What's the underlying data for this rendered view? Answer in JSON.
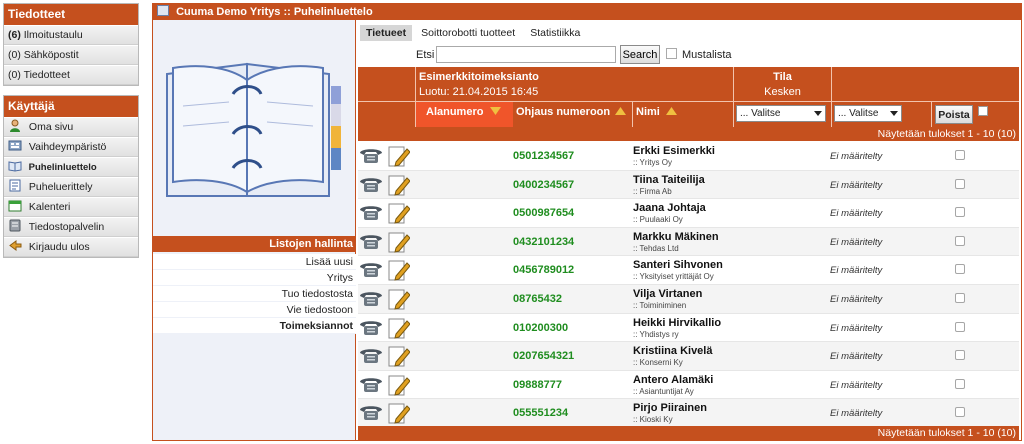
{
  "sidebar": {
    "section1": {
      "title": "Tiedotteet",
      "items": [
        {
          "count": "(6)",
          "label": "Ilmoitustaulu"
        },
        {
          "count": "(0)",
          "label": "Sähköpostit"
        },
        {
          "count": "(0)",
          "label": "Tiedotteet"
        }
      ]
    },
    "section2": {
      "title": "Käyttäjä",
      "items": [
        {
          "label": "Oma sivu",
          "icon": "user-icon"
        },
        {
          "label": "Vaihdeympäristö",
          "icon": "switchboard-icon"
        },
        {
          "label": "Puhelinluettelo",
          "icon": "phonebook-icon"
        },
        {
          "label": "Puheluerittely",
          "icon": "call-log-icon"
        },
        {
          "label": "Kalenteri",
          "icon": "calendar-icon"
        },
        {
          "label": "Tiedostopalvelin",
          "icon": "file-server-icon"
        },
        {
          "label": "Kirjaudu ulos",
          "icon": "logout-icon"
        }
      ]
    }
  },
  "panel": {
    "title": "Cuuma Demo Yritys :: Puhelinluettelo"
  },
  "list_mgmt": {
    "title": "Listojen hallinta",
    "items": [
      "Lisää uusi",
      "Yritys",
      "Tuo tiedostosta",
      "Vie tiedostoon",
      "Toimeksiannot"
    ]
  },
  "tabs": [
    "Tietueet",
    "Soittorobotti tuotteet",
    "Statistiikka"
  ],
  "search": {
    "label": "Etsi",
    "value": "",
    "button": "Search",
    "blacklist_label": "Mustalista"
  },
  "grid": {
    "assignment_title": "Esimerkkitoimeksianto",
    "created": "Luotu: 21.04.2015 16:45",
    "status_title": "Tila",
    "status_value": "Kesken",
    "col_number": "Alanumero",
    "col_redirect": "Ohjaus numeroon",
    "col_name": "Nimi",
    "select1": "... Valitse",
    "select2": "... Valitse",
    "delete_button": "Poista",
    "results_text": "Näytetään tulokset 1 - 10 (10)"
  },
  "rows": [
    {
      "number": "0501234567",
      "name": "Erkki Esimerkki",
      "company": ":: Yritys Oy",
      "status": "Ei määritelty"
    },
    {
      "number": "0400234567",
      "name": "Tiina Taiteilija",
      "company": ":: Firma Ab",
      "status": "Ei määritelty"
    },
    {
      "number": "0500987654",
      "name": "Jaana Johtaja",
      "company": ":: Puulaaki Oy",
      "status": "Ei määritelty"
    },
    {
      "number": "0432101234",
      "name": "Markku Mäkinen",
      "company": ":: Tehdas Ltd",
      "status": "Ei määritelty"
    },
    {
      "number": "0456789012",
      "name": "Santeri Sihvonen",
      "company": ":: Yksityiset yrittäjät Oy",
      "status": "Ei määritelty"
    },
    {
      "number": "08765432",
      "name": "Vilja Virtanen",
      "company": ":: Toiminiminen",
      "status": "Ei määritelty"
    },
    {
      "number": "010200300",
      "name": "Heikki Hirvikallio",
      "company": ":: Yhdistys ry",
      "status": "Ei määritelty"
    },
    {
      "number": "0207654321",
      "name": "Kristiina Kivelä",
      "company": ":: Konserni Ky",
      "status": "Ei määritelty"
    },
    {
      "number": "09888777",
      "name": "Antero Alamäki",
      "company": ":: Asiantuntijat Ay",
      "status": "Ei määritelty"
    },
    {
      "number": "055551234",
      "name": "Pirjo Piirainen",
      "company": ":: Kioski Ky",
      "status": "Ei määritelty"
    }
  ]
}
